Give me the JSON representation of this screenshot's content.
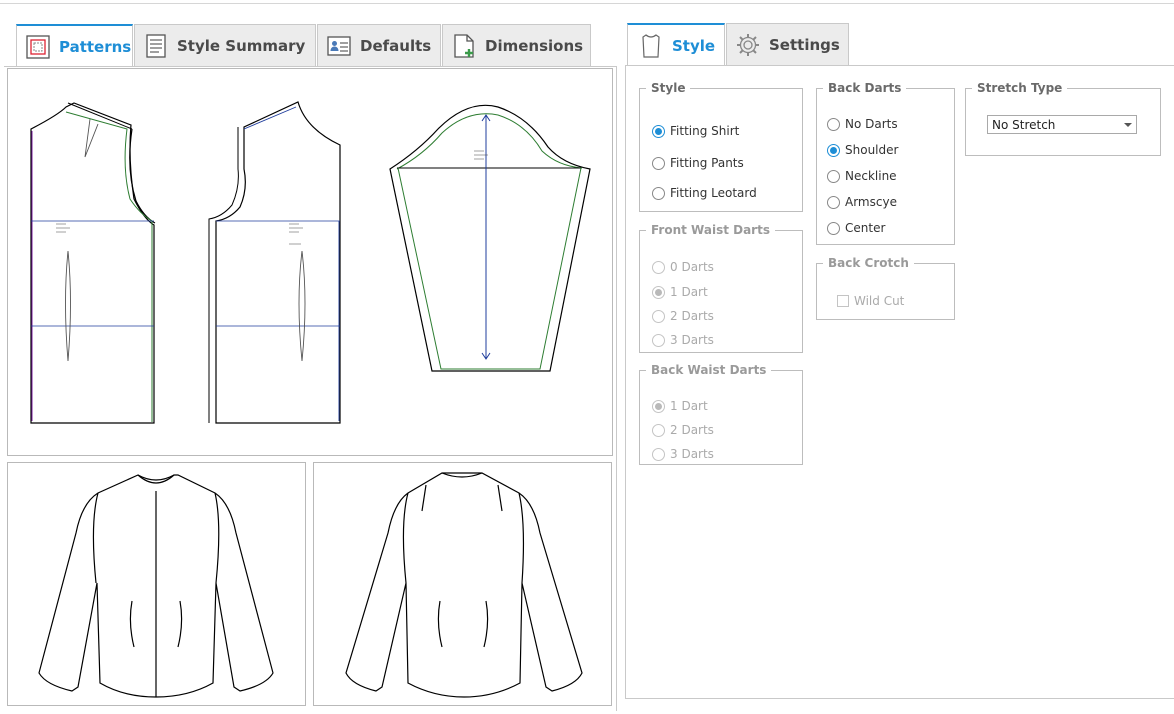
{
  "left_tabs": [
    {
      "label": "Patterns",
      "icon": "patterns-icon",
      "active": true
    },
    {
      "label": "Style Summary",
      "icon": "style-summary-icon",
      "active": false
    },
    {
      "label": "Defaults",
      "icon": "defaults-icon",
      "active": false
    },
    {
      "label": "Dimensions",
      "icon": "dimensions-icon",
      "active": false
    }
  ],
  "right_tabs": [
    {
      "label": "Style",
      "icon": "shirt-icon",
      "active": true
    },
    {
      "label": "Settings",
      "icon": "gear-icon",
      "active": false
    }
  ],
  "style_group": {
    "legend": "Style",
    "options": [
      "Fitting Shirt",
      "Fitting Pants",
      "Fitting Leotard"
    ],
    "selected": "Fitting Shirt"
  },
  "front_waist_darts": {
    "legend": "Front Waist Darts",
    "options": [
      "0 Darts",
      "1 Dart",
      "2 Darts",
      "3 Darts"
    ],
    "selected": "1 Dart",
    "enabled": false
  },
  "back_waist_darts": {
    "legend": "Back Waist Darts",
    "options": [
      "1 Dart",
      "2 Darts",
      "3 Darts"
    ],
    "selected": "1 Dart",
    "enabled": false
  },
  "back_darts": {
    "legend": "Back Darts",
    "options": [
      "No Darts",
      "Shoulder",
      "Neckline",
      "Armscye",
      "Center"
    ],
    "selected": "Shoulder"
  },
  "back_crotch": {
    "legend": "Back Crotch",
    "checkbox_label": "Wild Cut",
    "checked": false,
    "enabled": false
  },
  "stretch_type": {
    "legend": "Stretch Type",
    "value": "No Stretch"
  },
  "colors": {
    "accent": "#1e8ed6",
    "pattern_green": "#2e7d32",
    "pattern_blue": "#1f3c9c",
    "pattern_purple": "#7b1fa2"
  }
}
